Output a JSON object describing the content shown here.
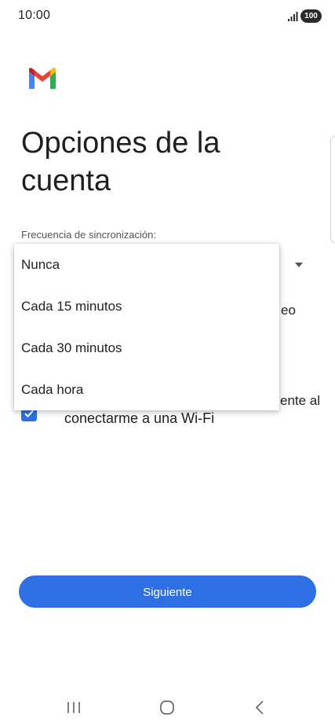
{
  "status_bar": {
    "time": "10:00",
    "battery": "100",
    "signal_icon": "signal-bars-icon"
  },
  "brand": {
    "logo_icon": "gmail-logo-icon",
    "colors": {
      "red": "#ea4335",
      "blue": "#4285f4",
      "green": "#34a853",
      "yellow": "#fbbc04",
      "dark_red": "#c5221f"
    }
  },
  "page": {
    "title_line1": "Opciones de la",
    "title_line2": "cuenta"
  },
  "sync": {
    "label": "Frecuencia de sincronización:",
    "dropdown_icon": "dropdown-arrow-icon",
    "options": [
      {
        "label": "Nunca"
      },
      {
        "label": "Cada 15 minutos"
      },
      {
        "label": "Cada 30 minutos"
      },
      {
        "label": "Cada hora"
      }
    ]
  },
  "obscured": {
    "peek_1": "eo",
    "peek_2": "ente al"
  },
  "wifi_option": {
    "checked": true,
    "label": "conectarme a una Wi-Fi"
  },
  "actions": {
    "next_label": "Siguiente"
  },
  "nav": {
    "recent_icon": "recent-apps-icon",
    "home_icon": "home-icon",
    "back_icon": "back-icon"
  },
  "colors": {
    "accent": "#2f6fe4",
    "text": "#1f1f1f"
  }
}
